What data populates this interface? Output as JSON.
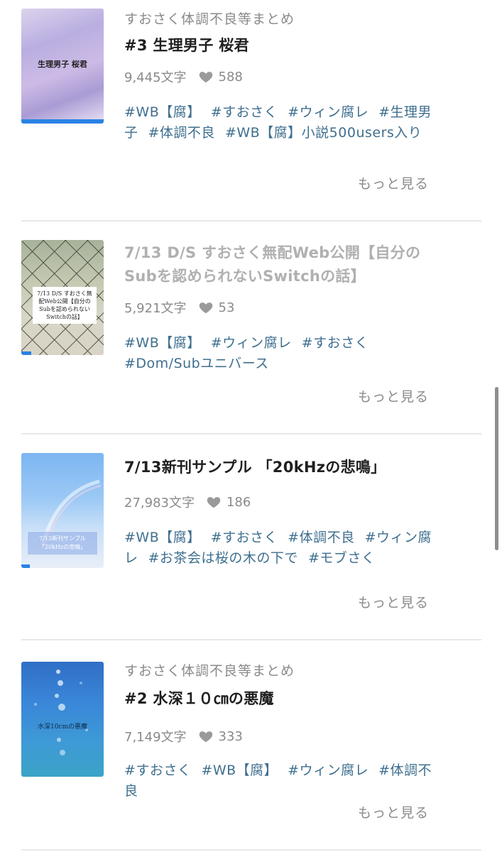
{
  "works": [
    {
      "series": "すおさく体調不良等まとめ",
      "title": "#3 生理男子 桜君",
      "chars": "9,445文字",
      "likes": "588",
      "tags": [
        "#WB【腐】",
        "#すおさく",
        "#ウィン腐レ",
        "#生理男子",
        "#体調不良",
        "#WB【腐】小説500users入り"
      ],
      "more": "もっと見る",
      "cover_text": "生理男子 桜君"
    },
    {
      "series": "",
      "title": "7/13 D/S すおさく無配Web公開【自分のSubを認められないSwitchの話】",
      "chars": "5,921文字",
      "likes": "53",
      "tags": [
        "#WB【腐】",
        "#ウィン腐レ",
        "#すおさく",
        "#Dom/Subユニバース"
      ],
      "more": "もっと見る",
      "cover_text": "7/13 D/S すおさく無配Web公開【自分のSubを認められないSwitchの話】"
    },
    {
      "series": "",
      "title": "7/13新刊サンプル 「20kHzの悲鳴」",
      "chars": "27,983文字",
      "likes": "186",
      "tags": [
        "#WB【腐】",
        "#すおさく",
        "#体調不良",
        "#ウィン腐レ",
        "#お茶会は桜の木の下で",
        "#モブさく"
      ],
      "more": "もっと見る",
      "cover_text": "7/13新刊サンプル「20kHzの悲鳴」"
    },
    {
      "series": "すおさく体調不良等まとめ",
      "title": "#2 水深１０㎝の悪魔",
      "chars": "7,149文字",
      "likes": "333",
      "tags": [
        "#すおさく",
        "#WB【腐】",
        "#ウィン腐レ",
        "#体調不良"
      ],
      "more": "もっと見る",
      "cover_text": "水深10cmの悪魔"
    }
  ],
  "colors": {
    "tag": "#3f6f8f",
    "muted": "#8a8a8a",
    "accent": "#2a82e4"
  },
  "icons": {
    "heart": "heart-icon"
  }
}
